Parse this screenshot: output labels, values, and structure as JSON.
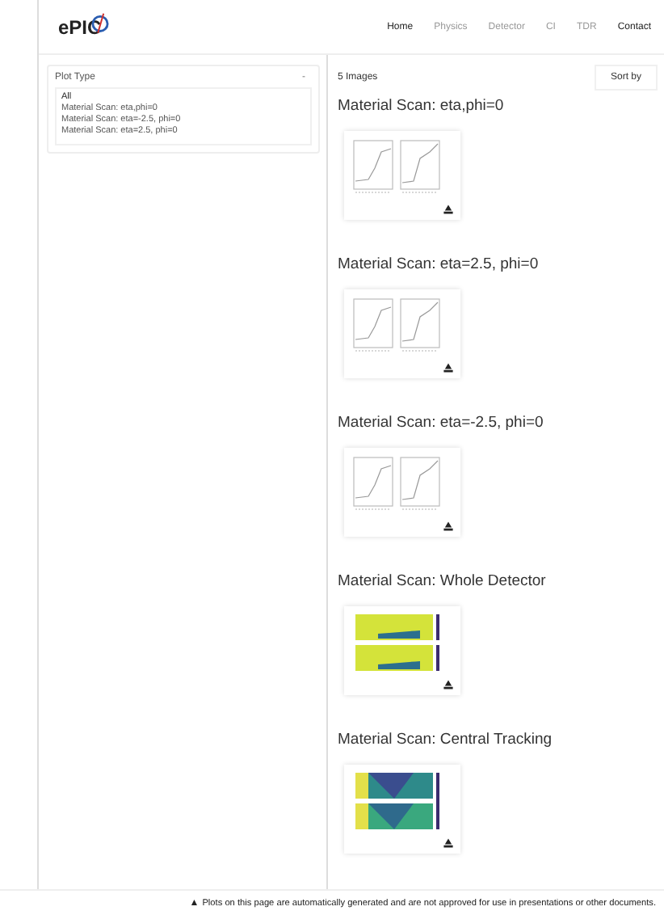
{
  "logo": "ePIC",
  "nav": [
    {
      "label": "Home",
      "selected": true
    },
    {
      "label": "Physics",
      "selected": false
    },
    {
      "label": "Detector",
      "selected": false
    },
    {
      "label": "CI",
      "selected": false
    },
    {
      "label": "TDR",
      "selected": false
    },
    {
      "label": "Contact",
      "selected": true
    }
  ],
  "sidebar": {
    "title": "Plot Type",
    "toggle": "-",
    "items": [
      {
        "label": "All",
        "selected": true
      },
      {
        "label": "Material Scan: eta,phi=0",
        "selected": false
      },
      {
        "label": "Material Scan: eta=-2.5, phi=0",
        "selected": false
      },
      {
        "label": "Material Scan: eta=2.5, phi=0",
        "selected": false
      }
    ]
  },
  "toolbar": {
    "count": "5 Images",
    "sort": "Sort by"
  },
  "galleries": [
    {
      "title": "Material Scan: eta,phi=0",
      "kind": "plots"
    },
    {
      "title": "Material Scan: eta=2.5, phi=0",
      "kind": "plots"
    },
    {
      "title": "Material Scan: eta=-2.5, phi=0",
      "kind": "plots"
    },
    {
      "title": "Material Scan: Whole Detector",
      "kind": "heatmap"
    },
    {
      "title": "Material Scan: Central Tracking",
      "kind": "heatmap2"
    }
  ],
  "footer": {
    "icon": "▲",
    "text": "Plots on this page are automatically generated and are not approved for use in presentations or other documents."
  }
}
